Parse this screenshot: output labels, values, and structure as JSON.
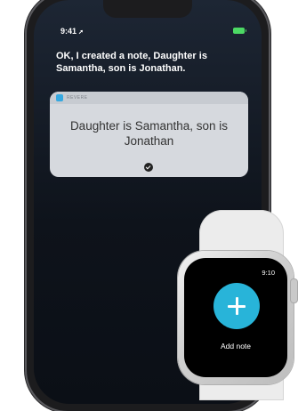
{
  "phone": {
    "status_bar": {
      "time": "9:41",
      "location_glyph": "➚",
      "battery_icon": "battery-icon",
      "battery_color": "#4cd964"
    },
    "siri_response": "OK, I created a note, Daughter is Samantha, son is Jonathan.",
    "note_card": {
      "app_name": "REVERE",
      "app_icon": "app-icon",
      "app_icon_color": "#35a8e0",
      "text": "Daughter is Samantha, son is Jonathan",
      "status_icon": "check-circle-icon"
    }
  },
  "watch": {
    "time": "9:10",
    "action_button": {
      "icon": "plus-icon",
      "color": "#28b4d9",
      "label": "Add note"
    }
  }
}
